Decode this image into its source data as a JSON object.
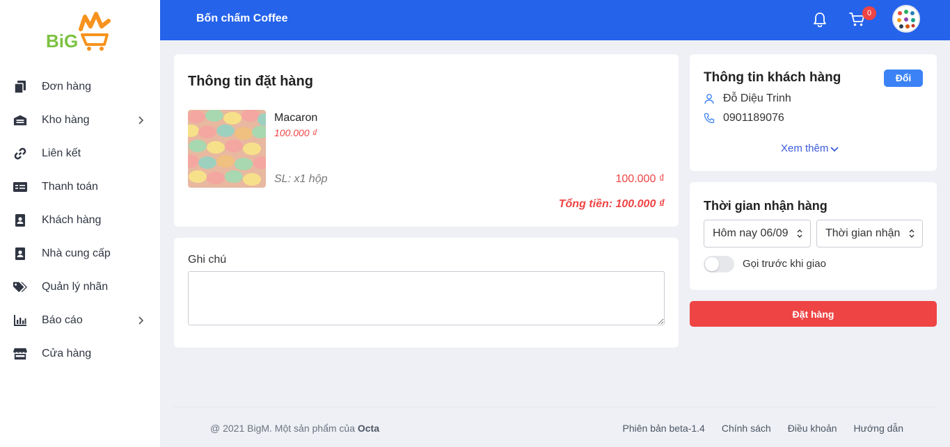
{
  "brand": {
    "logo_text": "BigM",
    "colors": {
      "primary": "#2563eb",
      "danger": "#ef4444",
      "logo_green": "#7cc242",
      "logo_orange": "#f7931e"
    }
  },
  "sidebar": {
    "items": [
      {
        "label": "Đơn hàng",
        "icon": "document-copy-icon",
        "has_children": false
      },
      {
        "label": "Kho hàng",
        "icon": "warehouse-icon",
        "has_children": true
      },
      {
        "label": "Liên kết",
        "icon": "link-icon",
        "has_children": false
      },
      {
        "label": "Thanh toán",
        "icon": "payment-card-icon",
        "has_children": false
      },
      {
        "label": "Khách hàng",
        "icon": "contact-book-icon",
        "has_children": false
      },
      {
        "label": "Nhà cung cấp",
        "icon": "supplier-book-icon",
        "has_children": false
      },
      {
        "label": "Quản lý nhãn",
        "icon": "tags-icon",
        "has_children": false
      },
      {
        "label": "Báo cáo",
        "icon": "bar-chart-icon",
        "has_children": true
      },
      {
        "label": "Cửa hàng",
        "icon": "store-icon",
        "has_children": false
      }
    ]
  },
  "header": {
    "store_name": "Bốn chấm Coffee",
    "cart_count": "0"
  },
  "order": {
    "title": "Thông tin đặt hàng",
    "product": {
      "name": "Macaron",
      "price": "100.000 ₫",
      "quantity": "SL: x1 hộp",
      "line_total": "100.000 ₫"
    },
    "grand_total": "Tổng tiền: 100.000 ₫"
  },
  "note": {
    "label": "Ghi chú",
    "value": ""
  },
  "customer": {
    "title": "Thông tin khách hàng",
    "change_label": "Đổi",
    "name": "Đỗ Diệu Trinh",
    "phone": "0901189076",
    "more_label": "Xem thêm"
  },
  "delivery": {
    "title": "Thời gian nhận hàng",
    "day_value": "Hôm nay 06/09",
    "time_value": "Thời gian nhận",
    "call_before_label": "Gọi trước khi giao",
    "call_before_on": false
  },
  "actions": {
    "place_order_label": "Đặt hàng"
  },
  "footer": {
    "copyright_prefix": "@ 2021 BigM. Một sản phẩm của ",
    "company": "Octa",
    "links": [
      "Phiên bản beta-1.4",
      "Chính sách",
      "Điều khoản",
      "Hướng dẫn"
    ]
  }
}
